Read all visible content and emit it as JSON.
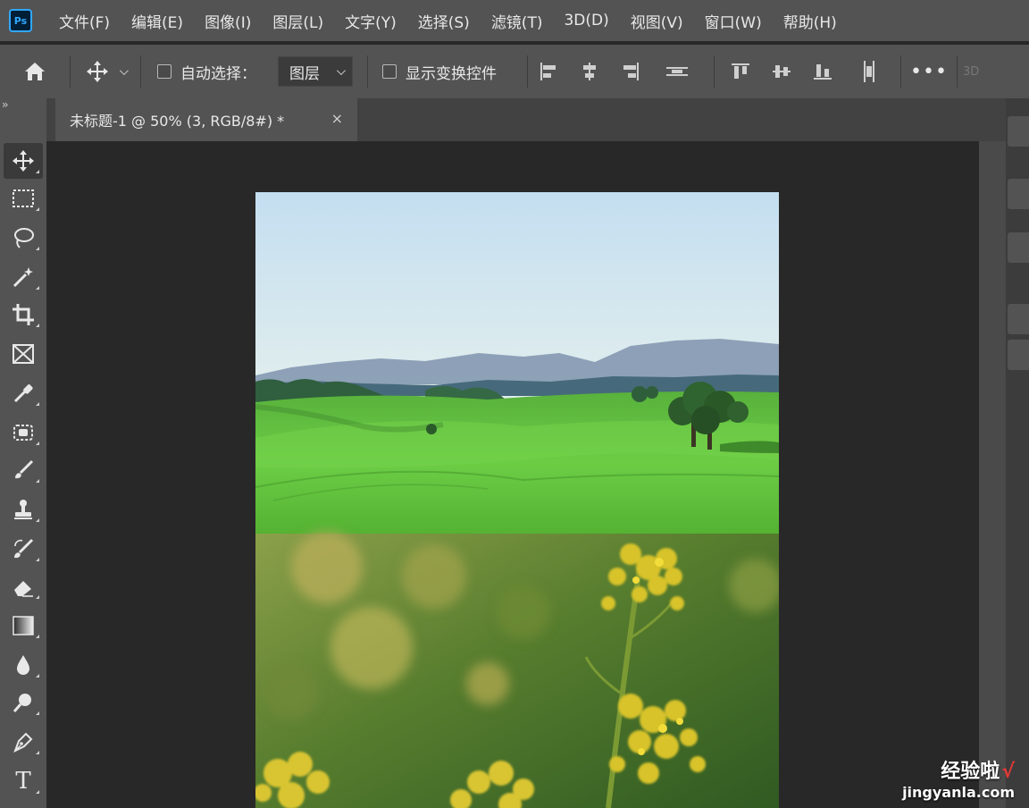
{
  "app": {
    "logo_text": "Ps"
  },
  "menu": {
    "items": [
      "文件(F)",
      "编辑(E)",
      "图像(I)",
      "图层(L)",
      "文字(Y)",
      "选择(S)",
      "滤镜(T)",
      "3D(D)",
      "视图(V)",
      "窗口(W)",
      "帮助(H)"
    ]
  },
  "options": {
    "auto_select_label": "自动选择：",
    "auto_select_checked": false,
    "layer_dropdown_value": "图层",
    "show_transform_label": "显示变换控件",
    "show_transform_checked": false,
    "more_label": "•••",
    "threed_label": "3D"
  },
  "document_tab": {
    "title": "未标题-1 @ 50% (3, RGB/8#) *",
    "close": "×"
  },
  "panel_collapse": "››",
  "tools": [
    "move-tool-icon",
    "marquee-tool-icon",
    "lasso-tool-icon",
    "magic-wand-tool-icon",
    "crop-tool-icon",
    "frame-tool-icon",
    "eyedropper-tool-icon",
    "spot-healing-tool-icon",
    "brush-tool-icon",
    "clone-stamp-tool-icon",
    "history-brush-tool-icon",
    "eraser-tool-icon",
    "gradient-tool-icon",
    "blur-tool-icon",
    "dodge-tool-icon",
    "pen-tool-icon",
    "type-tool-icon"
  ],
  "type_tool_glyph": "T",
  "canvas": {
    "top_layer": "landscape-photo",
    "bottom_layer": "rapeseed-flower-photo"
  },
  "watermark": {
    "cn": "经验啦",
    "check": "√",
    "en": "jingyanla.com"
  },
  "colors": {
    "ps_blue": "#31a8ff",
    "panel": "#535353",
    "workspace": "#282828"
  }
}
